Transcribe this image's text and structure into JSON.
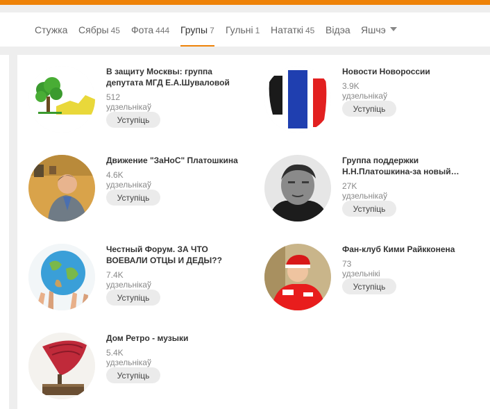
{
  "tabs": [
    {
      "label": "Стужка",
      "count": ""
    },
    {
      "label": "Сябры",
      "count": "45"
    },
    {
      "label": "Фота",
      "count": "444"
    },
    {
      "label": "Групы",
      "count": "7"
    },
    {
      "label": "Гульні",
      "count": "1"
    },
    {
      "label": "Нататкі",
      "count": "45"
    },
    {
      "label": "Відэа",
      "count": ""
    },
    {
      "label": "Яшчэ",
      "count": ""
    }
  ],
  "active_tab": "Групы",
  "groups": [
    {
      "name": "В защиту Москвы: группа депутата МГД Е.А.Шуваловой",
      "members": "512 удзельнікаў",
      "join": "Уступіць",
      "icon": "tree-logo"
    },
    {
      "name": "Новости Новороссии",
      "members": "3.9K удзельнікаў",
      "join": "Уступіць",
      "icon": "flag-logo"
    },
    {
      "name": "Движение \"ЗаНоС\" Платошкина",
      "members": "4.6K удзельнікаў",
      "join": "Уступіць",
      "icon": "man-portrait"
    },
    {
      "name": "Группа поддержки Н.Н.Платошкина-за новый…",
      "members": "27K удзельнікаў",
      "join": "Уступіць",
      "icon": "man-portrait-bw"
    },
    {
      "name": "Честный Форум. ЗА ЧТО ВОЕВАЛИ ОТЦЫ И ДЕДЫ??",
      "members": "7.4K удзельнікаў",
      "join": "Уступіць",
      "icon": "globe-hands"
    },
    {
      "name": "Фан-клуб Кими Райкконена",
      "members": "73 удзельнікі",
      "join": "Уступіць",
      "icon": "racer-portrait"
    },
    {
      "name": "Дом Ретро - музыки",
      "members": "5.4K удзельнікаў",
      "join": "Уступіць",
      "icon": "gramophone"
    }
  ],
  "colors": {
    "accent": "#ee8208",
    "button_bg": "#ebebeb",
    "text": "#333333",
    "muted": "#888888"
  }
}
